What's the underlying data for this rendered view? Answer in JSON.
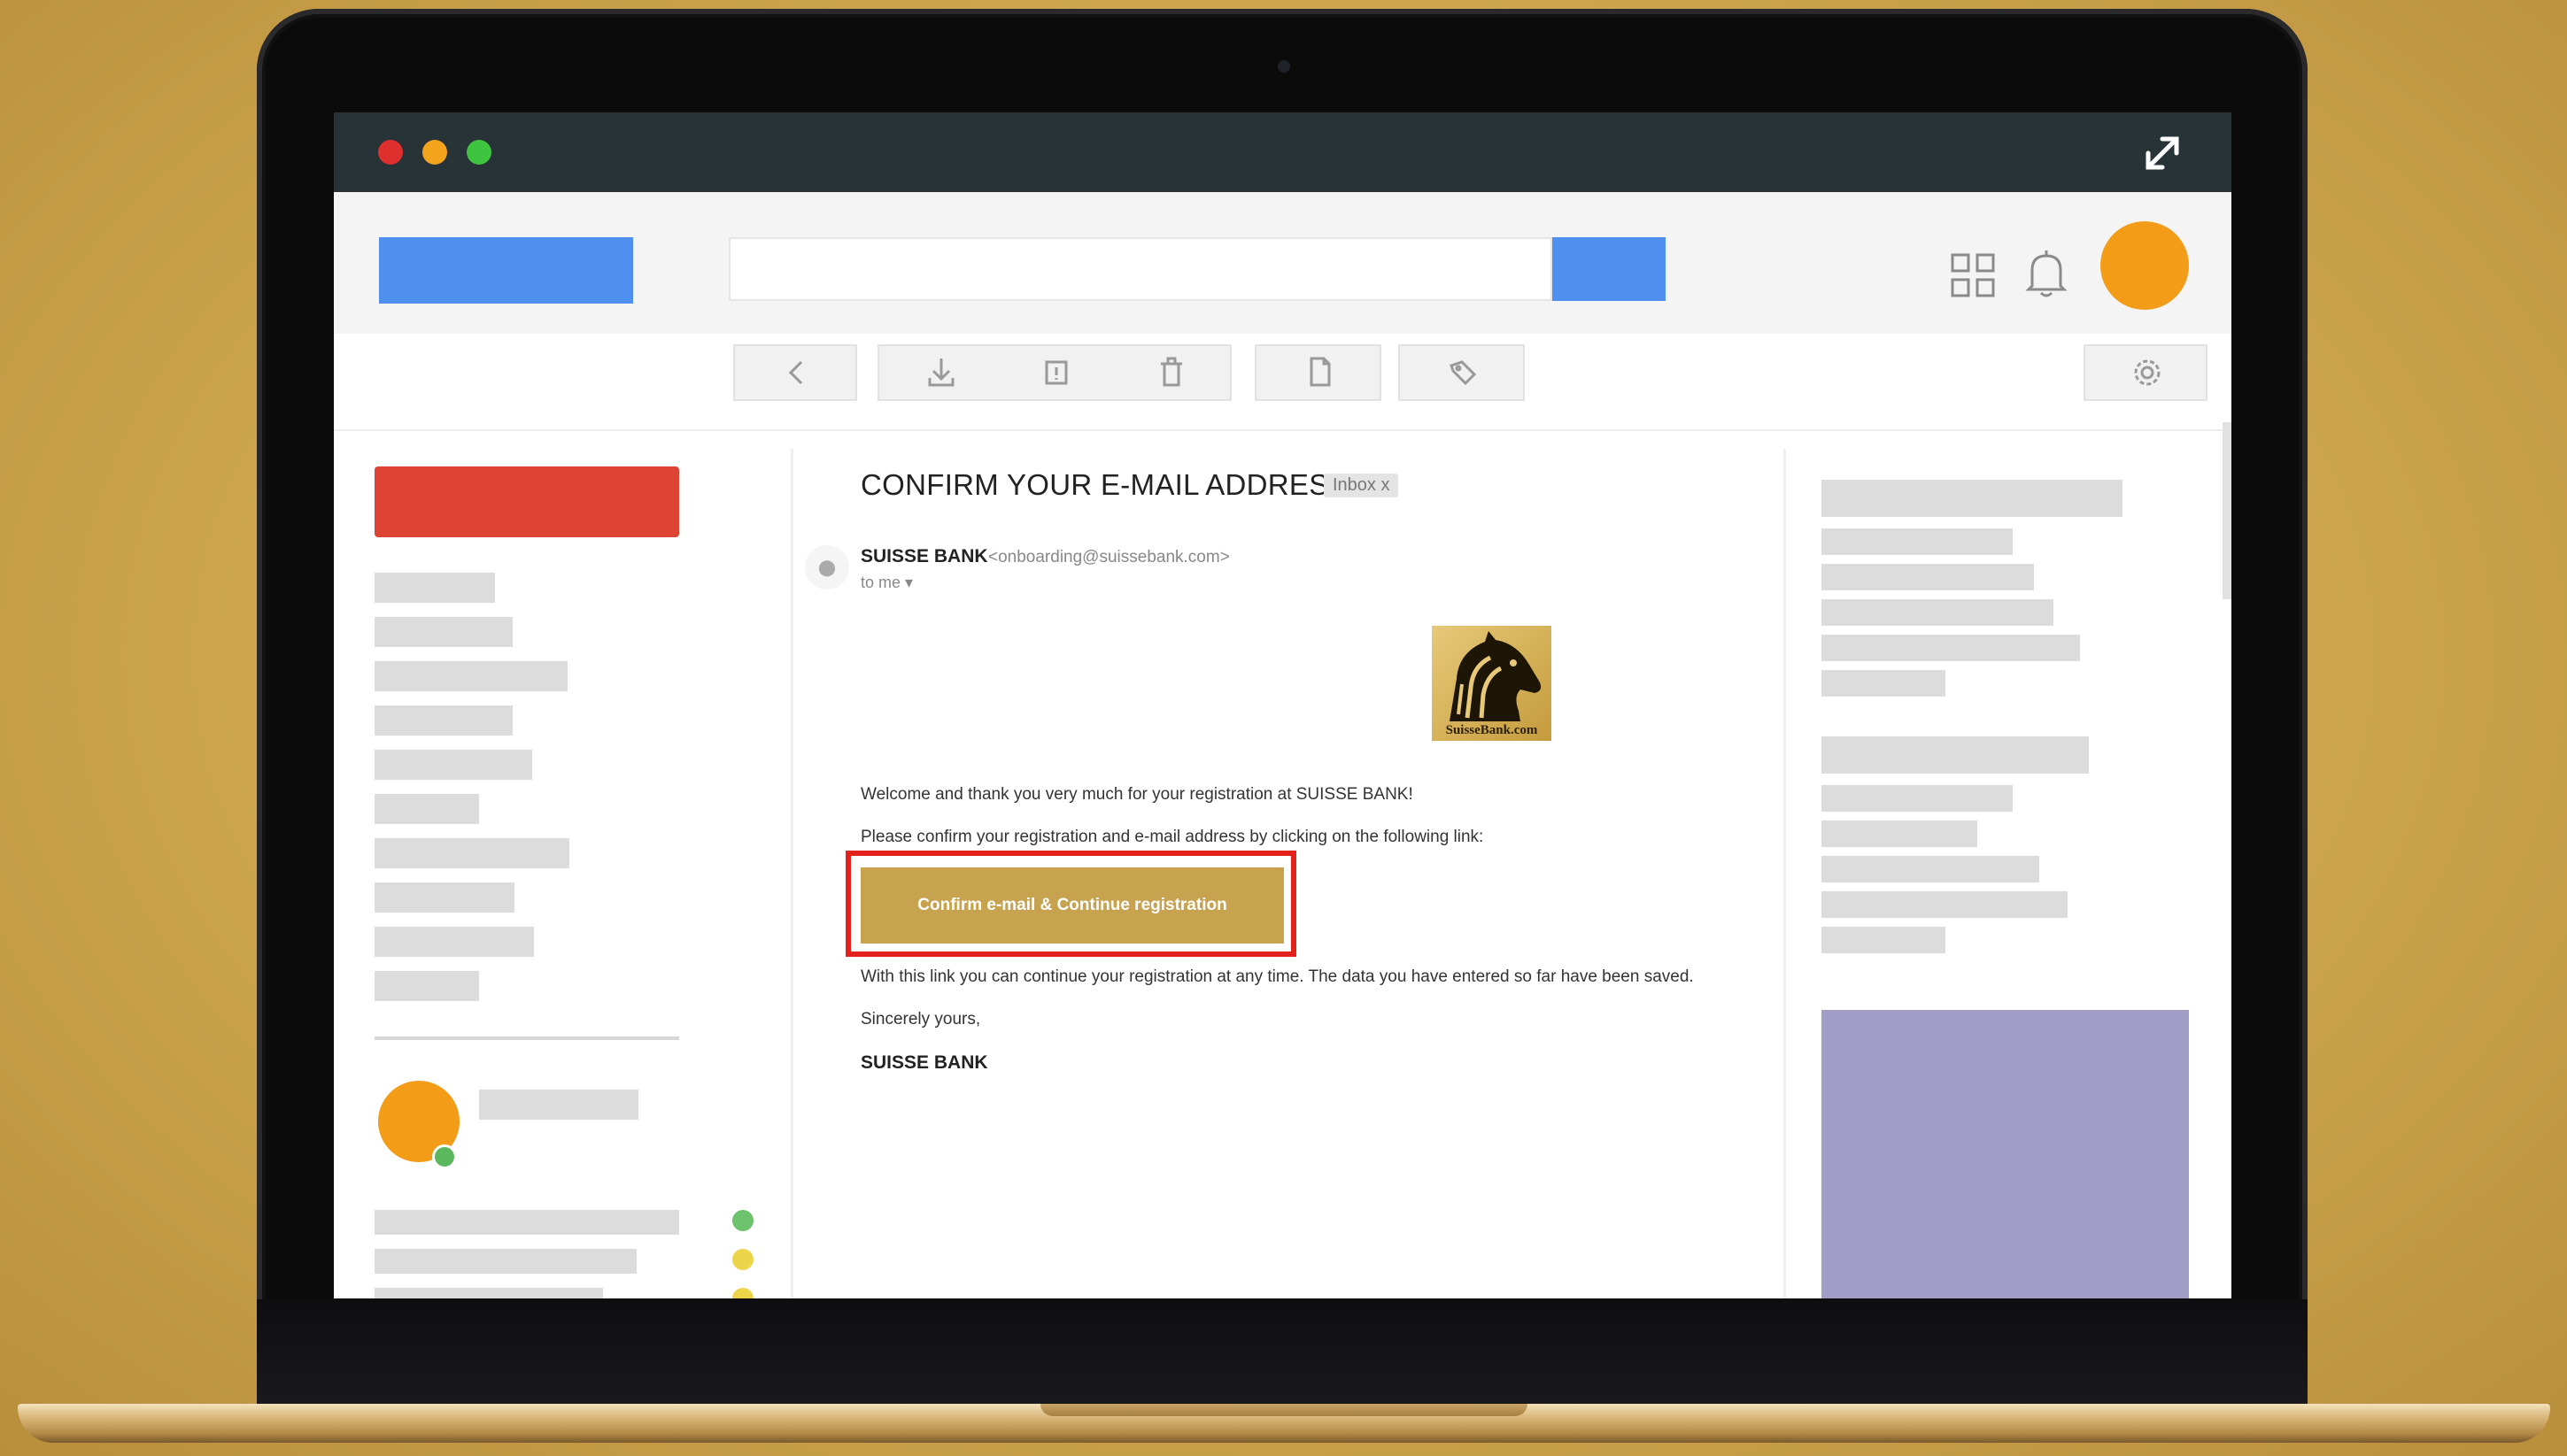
{
  "titlebar": {
    "dots": [
      {
        "name": "close",
        "color": "#e0302d"
      },
      {
        "name": "minimize",
        "color": "#f2a51c"
      },
      {
        "name": "maximize",
        "color": "#3fc43f"
      }
    ],
    "expand_icon": "expand-arrows-icon"
  },
  "topbar": {
    "search_placeholder": "",
    "icons": [
      "apps-grid-icon",
      "bell-icon"
    ],
    "avatar_color": "#f39c18"
  },
  "toolbar": {
    "icons": [
      "back-arrow-icon",
      "archive-download-icon",
      "report-icon",
      "trash-icon",
      "document-icon",
      "tag-icon",
      "gear-icon"
    ]
  },
  "colors": {
    "compose": "#dd4433",
    "accent_blue": "#4f8ff0",
    "cta": "#c7a24f",
    "highlight": "#e3221c",
    "ad_block": "#a09ec6"
  },
  "email": {
    "subject": "CONFIRM YOUR E-MAIL ADDRESS",
    "badge": "Inbox x",
    "sender_name": "SUISSE BANK",
    "sender_email": "<onboarding@suissebank.com>",
    "to": "to me ▾",
    "logo_text": "SuisseBank.com",
    "paragraph_1": "Welcome and thank you very much for your registration at SUISSE BANK!",
    "paragraph_2": "Please confirm your registration and e-mail address by clicking on the following link:",
    "cta_label": "Confirm e-mail & Continue registration",
    "paragraph_3": "With this link you can continue your registration at any time. The data you have entered so far have been saved.",
    "closing": "Sincerely yours,",
    "signature": "SUISSE BANK"
  }
}
